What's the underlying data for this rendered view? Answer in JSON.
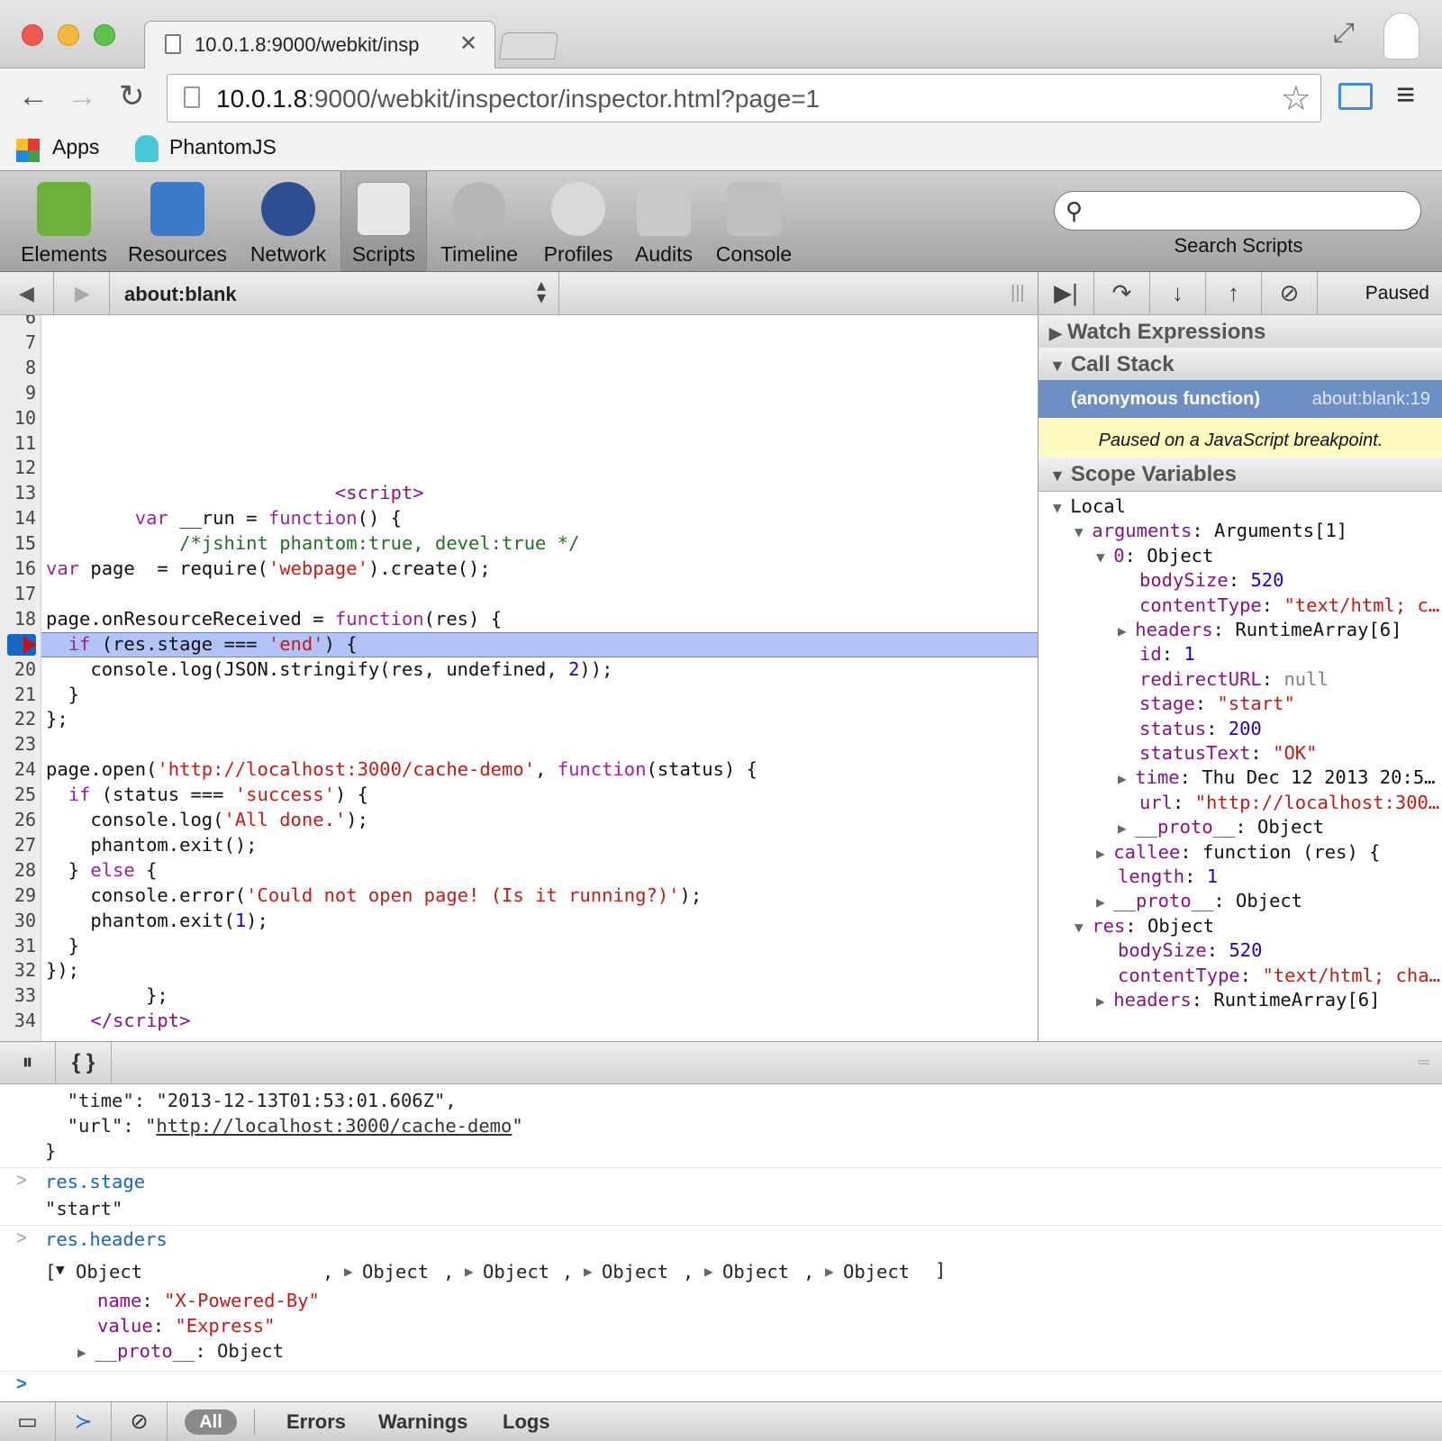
{
  "tab": {
    "title": "10.0.1.8:9000/webkit/insp",
    "close": "✕"
  },
  "address": {
    "host": "10.0.1.8",
    "rest": ":9000/webkit/inspector/inspector.html?page=1"
  },
  "bookmarks": [
    {
      "label": "Apps"
    },
    {
      "label": "PhantomJS"
    }
  ],
  "inspector_tabs": [
    {
      "label": "Elements",
      "color": "#6fb03a"
    },
    {
      "label": "Resources",
      "color": "#3c79c9"
    },
    {
      "label": "Network",
      "color": "#2f4f94"
    },
    {
      "label": "Scripts",
      "color": "#cfcfcf"
    },
    {
      "label": "Timeline",
      "color": "#b6b6b6"
    },
    {
      "label": "Profiles",
      "color": "#d9d9d9"
    },
    {
      "label": "Audits",
      "color": "#c9c9c9"
    },
    {
      "label": "Console",
      "color": "#bfbfbf"
    }
  ],
  "search": {
    "label": "Search Scripts",
    "placeholder": ""
  },
  "scripts": {
    "file": "about:blank",
    "status": "Paused"
  },
  "code": {
    "line_numbers": [
      "6",
      "7",
      "8",
      "9",
      "10",
      "11",
      "12",
      "13",
      "14",
      "15",
      "16",
      "17",
      "18",
      "19",
      "20",
      "21",
      "22",
      "23",
      "24",
      "25",
      "26",
      "27",
      "28",
      "29",
      "30",
      "31",
      "32",
      "33",
      "34"
    ],
    "lines": [
      {
        "n": "13",
        "html": "                          <span class='tag'>&lt;script&gt;</span>"
      },
      {
        "n": "14",
        "html": "        <span class='kw'>var</span> __run = <span class='kw'>function</span>() {"
      },
      {
        "n": "15",
        "html": "            <span class='cm'>/*jshint phantom:true, devel:true */</span>"
      },
      {
        "n": "16",
        "html": "<span class='kw'>var</span> page  = require(<span class='str'>'webpage'</span>).create();"
      },
      {
        "n": "18",
        "html": "page.onResourceReceived = <span class='kw'>function</span>(res) {"
      },
      {
        "n": "19",
        "html": "  <span class='kw'>if</span> (res.stage === <span class='str'>'end'</span>) {"
      },
      {
        "n": "20",
        "html": "    console.log(JSON.stringify(res, undefined, <span class='num'>2</span>));"
      },
      {
        "n": "21",
        "html": "  }"
      },
      {
        "n": "22",
        "html": "};"
      },
      {
        "n": "24",
        "html": "page.open(<span class='str'>'http://localhost:3000/cache-demo'</span>, <span class='kw'>function</span>(status) {"
      },
      {
        "n": "25",
        "html": "  <span class='kw'>if</span> (status === <span class='str'>'success'</span>) {"
      },
      {
        "n": "26",
        "html": "    console.log(<span class='str'>'All done.'</span>);"
      },
      {
        "n": "27",
        "html": "    phantom.exit();"
      },
      {
        "n": "28",
        "html": "  } <span class='kw'>else</span> {"
      },
      {
        "n": "29",
        "html": "    console.error(<span class='str'>'Could not open page! (Is it running?)'</span>);"
      },
      {
        "n": "30",
        "html": "    phantom.exit(<span class='num'>1</span>);"
      },
      {
        "n": "31",
        "html": "  }"
      },
      {
        "n": "32",
        "html": "});"
      },
      {
        "n": "33",
        "html": "         };"
      },
      {
        "n": "34",
        "html": "    <span class='tag'>&lt;/script&gt;</span>"
      }
    ]
  },
  "sidebar": {
    "watch": "Watch Expressions",
    "callstack": "Call Stack",
    "frame_fn": "(anonymous function)",
    "frame_loc": "about:blank:19",
    "paused_msg": "Paused on a JavaScript breakpoint.",
    "scope": "Scope Variables",
    "scope_lines": [
      {
        "i": 0,
        "t": "▼",
        "html": "Local"
      },
      {
        "i": 1,
        "t": "▼",
        "html": "<span class='pn'>arguments</span>: Arguments[1]"
      },
      {
        "i": 2,
        "t": "▼",
        "html": "<span class='pn'>0</span>: Object"
      },
      {
        "i": 3,
        "t": "",
        "html": "<span class='pn'>bodySize</span>: <span class='num'>520</span>"
      },
      {
        "i": 3,
        "t": "",
        "html": "<span class='pn'>contentType</span>: <span class='str'>\"text/html; c…</span>"
      },
      {
        "i": 3,
        "t": "▶",
        "html": "<span class='pn'>headers</span>: RuntimeArray[6]"
      },
      {
        "i": 3,
        "t": "",
        "html": "<span class='pn'>id</span>: <span class='num'>1</span>"
      },
      {
        "i": 3,
        "t": "",
        "html": "<span class='pn'>redirectURL</span>: <span style='color:#808080'>null</span>"
      },
      {
        "i": 3,
        "t": "",
        "html": "<span class='pn'>stage</span>: <span class='str'>\"start\"</span>"
      },
      {
        "i": 3,
        "t": "",
        "html": "<span class='pn'>status</span>: <span class='num'>200</span>"
      },
      {
        "i": 3,
        "t": "",
        "html": "<span class='pn'>statusText</span>: <span class='str'>\"OK\"</span>"
      },
      {
        "i": 3,
        "t": "▶",
        "html": "<span class='pn'>time</span>: Thu Dec 12 2013 20:5…"
      },
      {
        "i": 3,
        "t": "",
        "html": "<span class='pn'>url</span>: <span class='str'>\"http://localhost:300…</span>"
      },
      {
        "i": 3,
        "t": "▶",
        "html": "<span class='pn'>__proto__</span>: Object"
      },
      {
        "i": 2,
        "t": "▶",
        "html": "<span class='pn'>callee</span>: function (res) {"
      },
      {
        "i": 2,
        "t": "",
        "html": "<span class='pn'>length</span>: <span class='num'>1</span>"
      },
      {
        "i": 2,
        "t": "▶",
        "html": "<span class='pn'>__proto__</span>: Object"
      },
      {
        "i": 1,
        "t": "▼",
        "html": "<span class='pn'>res</span>: Object"
      },
      {
        "i": 2,
        "t": "",
        "html": "<span class='pn'>bodySize</span>: <span class='num'>520</span>"
      },
      {
        "i": 2,
        "t": "",
        "html": "<span class='pn'>contentType</span>: <span class='str'>\"text/html; cha…</span>"
      },
      {
        "i": 2,
        "t": "▶",
        "html": "<span class='pn'>headers</span>: RuntimeArray[6]"
      }
    ]
  },
  "console": {
    "out1": "  \"time\": \"2013-12-13T01:53:01.606Z\",",
    "out2_a": "  \"url\": \"",
    "out2_link": "http://localhost:3000/cache-demo",
    "out2_b": "\"",
    "out3": "}",
    "in1": "res.stage",
    "res1": "\"start\"",
    "in2": "res.headers",
    "arr_open": "[",
    "obj": "Object",
    "comma": ",",
    "arr_close": "]",
    "name_key": "name",
    "name_val": "\"X-Powered-By\"",
    "value_key": "value",
    "value_val": "\"Express\"",
    "proto": "__proto__",
    "proto_val": ": Object"
  },
  "filters": {
    "all": "All",
    "errors": "Errors",
    "warnings": "Warnings",
    "logs": "Logs"
  }
}
